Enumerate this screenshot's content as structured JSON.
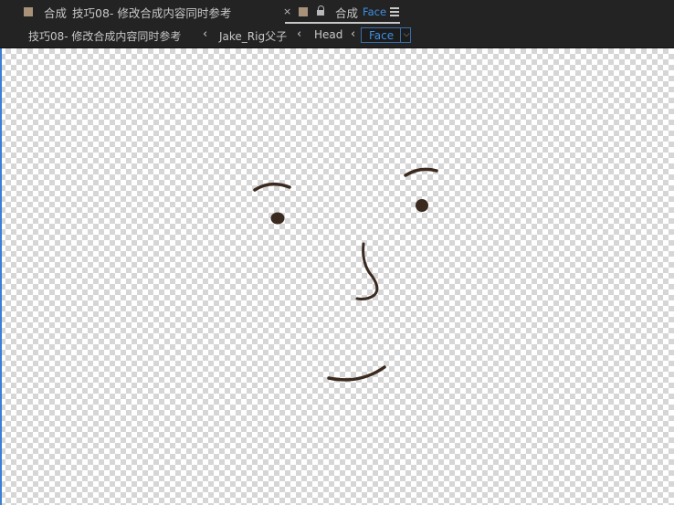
{
  "tabs": [
    {
      "prefix": "合成",
      "name": "技巧08- 修改合成内容同时参考",
      "swatch": "#a8937a",
      "active": false
    },
    {
      "prefix": "合成",
      "name": "Face",
      "swatch": "#a8937a",
      "active": true
    }
  ],
  "breadcrumb": {
    "items": [
      "技巧08- 修改合成内容同时参考",
      "Jake_Rig父子",
      "Head"
    ],
    "current": "Face"
  },
  "colors": {
    "panel_bg": "#232323",
    "accent_blue": "#3d8fe0",
    "swatch": "#a8937a",
    "face_stroke": "#3a2a20"
  }
}
